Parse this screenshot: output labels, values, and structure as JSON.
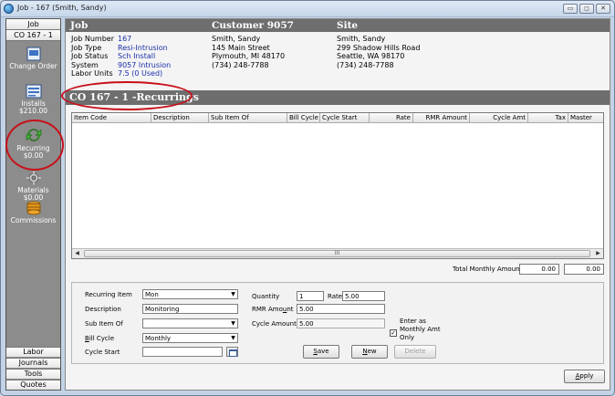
{
  "window": {
    "title": "Job - 167 (Smith, Sandy)",
    "controls": {
      "minimize": "▭",
      "restore": "◻",
      "close": "✕"
    }
  },
  "nav": {
    "top_buttons": [
      "Job",
      "CO 167 - 1"
    ],
    "items": [
      {
        "label": "Change Order",
        "amount": "",
        "icon": "change-order-icon"
      },
      {
        "label": "Installs",
        "amount": "$210.00",
        "icon": "installs-icon"
      },
      {
        "label": "Recurring",
        "amount": "$0.00",
        "icon": "recurring-icon"
      },
      {
        "label": "Materials",
        "amount": "$0.00",
        "icon": "materials-icon"
      },
      {
        "label": "Commissions",
        "amount": "",
        "icon": "commissions-icon"
      }
    ],
    "bottom_buttons": [
      "Labor",
      "Journals",
      "Tools",
      "Quotes"
    ]
  },
  "job_header": {
    "job": "Job",
    "customer": "Customer 9057",
    "site": "Site"
  },
  "job_info": {
    "labels": [
      "Job Number",
      "Job Type",
      "Job Status",
      "System",
      "Labor Units"
    ],
    "values": [
      "167",
      "Resi-Intrusion",
      "Sch Install",
      "9057 Intrusion",
      "7.5 (0 Used)"
    ]
  },
  "customer_info": [
    "Smith, Sandy",
    "145 Main Street",
    "Plymouth, MI  48170",
    "(734) 248-7788"
  ],
  "site_info": [
    "Smith, Sandy",
    "299 Shadow Hills Road",
    "Seattle, WA  98170",
    "(734) 248-7788"
  ],
  "section_title": "CO 167 - 1 -Recurrings",
  "grid": {
    "columns": [
      "Item Code",
      "Description",
      "Sub Item Of",
      "Bill Cycle",
      "Cycle Start",
      "Rate",
      "RMR Amount",
      "Cycle Amt",
      "Tax",
      "Master"
    ],
    "rows": [],
    "scroll_grip": "III"
  },
  "totals": {
    "label": "Total Monthly Amount",
    "value1": "0.00",
    "value2": "0.00"
  },
  "form": {
    "recurring_item_label": "Recurring Item",
    "recurring_item_value": "Mon",
    "description_label": "Description",
    "description_value": "Monitoring",
    "sub_item_of_label": "Sub Item Of",
    "sub_item_of_value": "",
    "bill_cycle_label_b": "B",
    "bill_cycle_label_rest": "ill Cycle",
    "bill_cycle_value": "Monthly",
    "cycle_start_label": "Cycle Start",
    "cycle_start_value": "",
    "quantity_label": "Quantity",
    "quantity_value": "1",
    "rate_label": "Rate",
    "rate_value": "5.00",
    "rmr_amount_label_pre": "RMR Amo",
    "rmr_amount_label_u": "u",
    "rmr_amount_label_post": "nt",
    "rmr_amount_value": "5.00",
    "cycle_amount_label": "Cycle Amount",
    "cycle_amount_value": "5.00",
    "enter_as_monthly": "Enter as\nMonthly Amt\nOnly",
    "enter_as_monthly_checked": "✓",
    "save_u": "S",
    "save_rest": "ave",
    "new_u": "N",
    "new_rest": "ew",
    "delete": "Delete",
    "apply_u": "A",
    "apply_rest": "pply"
  },
  "colors": {
    "header_bg": "#6e6e6e",
    "nav_bg": "#8c8c8c",
    "link_blue": "#1a2fa8",
    "highlight_red": "#c8101a"
  }
}
